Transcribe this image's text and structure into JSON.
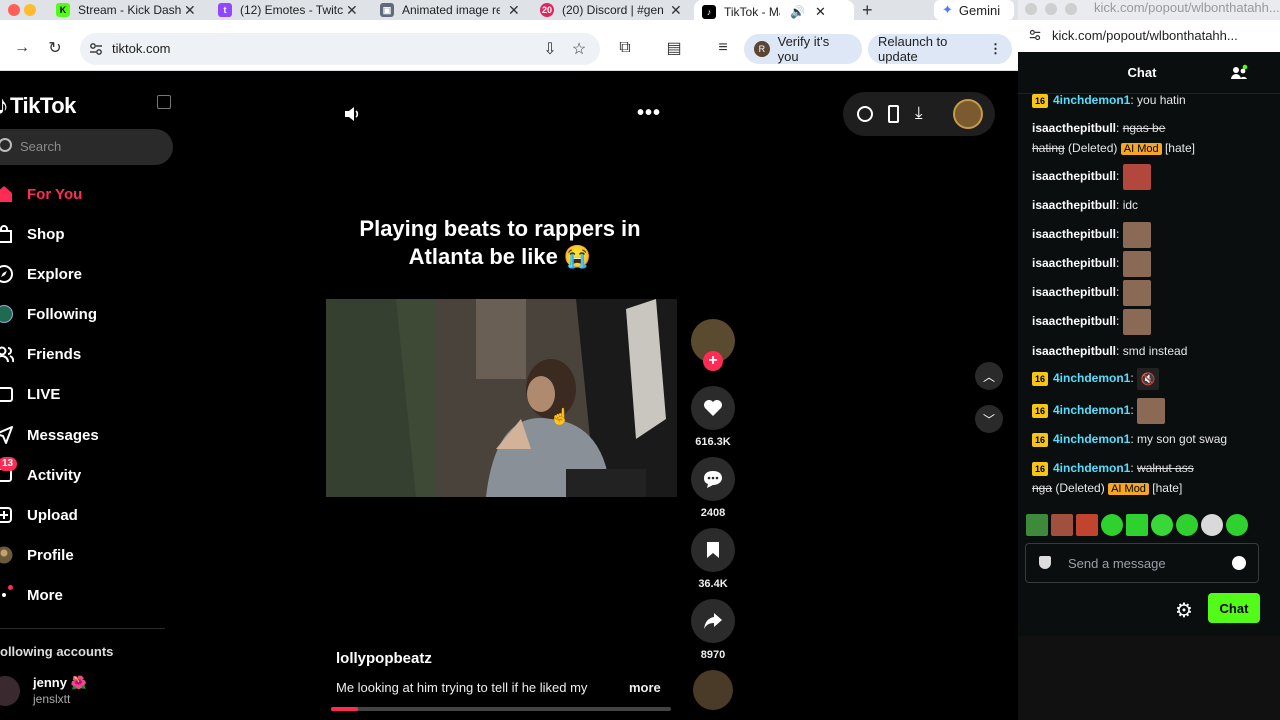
{
  "browser": {
    "tabs": [
      {
        "title": "Stream - Kick Dash",
        "favicon": "kick-favicon",
        "color": "#53fc18"
      },
      {
        "title": "(12) Emotes - Twitc",
        "favicon": "twitch-favicon",
        "color": "#9146ff"
      },
      {
        "title": "Animated image re",
        "favicon": "image-favicon",
        "color": "#5f6b7a"
      },
      {
        "title": "(20) Discord | #gen",
        "favicon": "discord-favicon",
        "color": "#e0245e",
        "badge": "20"
      },
      {
        "title": "TikTok - Make ",
        "favicon": "tiktok-favicon",
        "color": "#000000"
      }
    ],
    "gemini_label": "Gemini",
    "url": "tiktok.com",
    "verify_label": "Verify it's you",
    "verify_avatar_letter": "R",
    "relaunch_label": "Relaunch to update"
  },
  "tiktok": {
    "logo": "TikTok",
    "search_placeholder": "Search",
    "nav": [
      {
        "label": "For You",
        "icon": "home-icon",
        "active": true
      },
      {
        "label": "Shop",
        "icon": "shop-icon"
      },
      {
        "label": "Explore",
        "icon": "compass-icon"
      },
      {
        "label": "Following",
        "icon": "following-icon"
      },
      {
        "label": "Friends",
        "icon": "friends-icon"
      },
      {
        "label": "LIVE",
        "icon": "live-icon"
      },
      {
        "label": "Messages",
        "icon": "messages-icon"
      },
      {
        "label": "Activity",
        "icon": "activity-icon",
        "badge": "13"
      },
      {
        "label": "Upload",
        "icon": "upload-icon"
      },
      {
        "label": "Profile",
        "icon": "profile-icon"
      },
      {
        "label": "More",
        "icon": "more-icon"
      }
    ],
    "following_header": "ollowing accounts",
    "following_account": {
      "name": "jenny 🌺",
      "handle": "jenslxtt"
    },
    "video": {
      "caption_line1": "Playing beats to rappers in",
      "caption_line2": "Atlanta be like 😭",
      "author": "lollypopbeatz",
      "description": "Me looking at him trying to tell if he liked my",
      "more_label": "more",
      "progress": 0.08
    },
    "actions": {
      "likes": "616.3K",
      "comments": "2408",
      "saves": "36.4K",
      "shares": "8970"
    },
    "accent": "#fe2c55"
  },
  "kick": {
    "window_url_title": "kick.com/popout/wlbonthatahh...",
    "url": "kick.com/popout/wlbonthatahh...",
    "header": "Chat",
    "messages": [
      {
        "user": "4inchdemon1",
        "badge": "16",
        "text": "you hatin"
      },
      {
        "user": "isaacthepitbull",
        "deleted_text1": "ngas be",
        "deleted_text2": "hating",
        "deleted_label": "(Deleted)",
        "mod": "AI Mod",
        "reason": "[hate]"
      },
      {
        "user": "isaacthepitbull",
        "emote": "face-emote"
      },
      {
        "user": "isaacthepitbull",
        "text": "idc"
      },
      {
        "user": "isaacthepitbull",
        "emote": "face-emote"
      },
      {
        "user": "isaacthepitbull",
        "emote": "face-emote"
      },
      {
        "user": "isaacthepitbull",
        "emote": "face-emote"
      },
      {
        "user": "isaacthepitbull",
        "emote": "face-emote"
      },
      {
        "user": "isaacthepitbull",
        "text": "smd instead"
      },
      {
        "user": "4inchdemon1",
        "badge": "16",
        "emote": "mute-emote"
      },
      {
        "user": "4inchdemon1",
        "badge": "16",
        "emote": "face-emote"
      },
      {
        "user": "4inchdemon1",
        "badge": "16",
        "text": "my son got swag"
      },
      {
        "user": "4inchdemon1",
        "badge": "16",
        "deleted_text1": "walnut ass",
        "deleted_text2": "nga",
        "deleted_label": "(Deleted)",
        "mod": "AI Mod",
        "reason": "[hate]"
      }
    ],
    "input_placeholder": "Send a message",
    "send_label": "Chat",
    "send_color": "#53fc18"
  }
}
